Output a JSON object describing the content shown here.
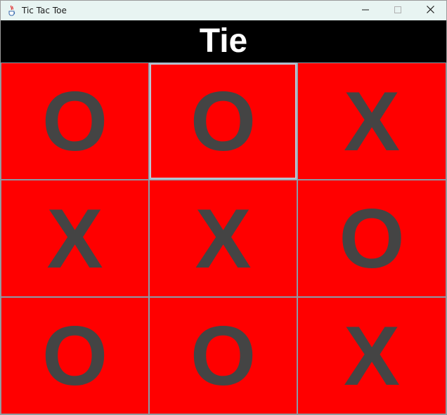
{
  "window": {
    "title": "Tic Tac Toe",
    "icon": "java-cup-icon",
    "controls": [
      "minimize-icon",
      "maximize-icon",
      "close-icon"
    ]
  },
  "status": {
    "text": "Tie"
  },
  "board": {
    "cells": [
      "O",
      "O",
      "X",
      "X",
      "X",
      "O",
      "O",
      "O",
      "X"
    ],
    "focused_index": 1
  },
  "colors": {
    "titlebar_bg": "#e8f4f2",
    "header_bg": "#000000",
    "header_text": "#ffffff",
    "cell_bg": "#ff0000",
    "mark_color": "#444444",
    "cell_border": "#8c9aa6"
  }
}
